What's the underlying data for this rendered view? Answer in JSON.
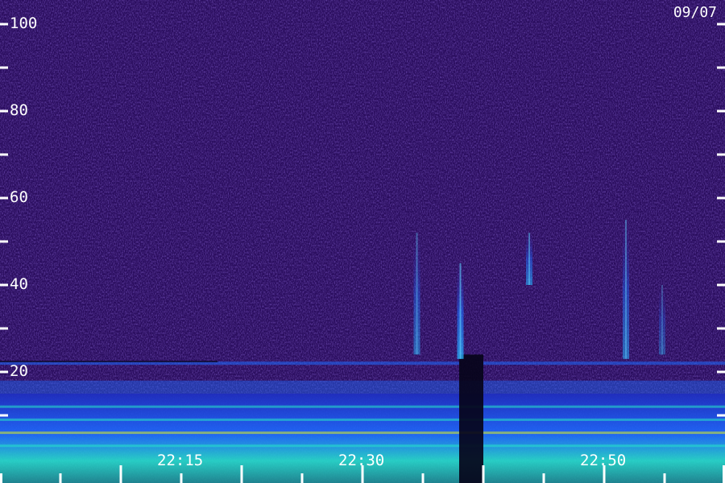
{
  "chart_data": {
    "type": "heatmap",
    "date_label": "09/07",
    "colors": {
      "background": "#2a0d5e",
      "low": "#3b1fb0",
      "mid": "#1e6bff",
      "high": "#27e6c8",
      "peak": "#d8f020",
      "tick": "#ffffff"
    },
    "y_axis": {
      "range": [
        0,
        100
      ],
      "labeled_ticks": [
        20,
        40,
        60,
        80,
        100
      ],
      "minor_ticks": [
        10,
        30,
        50,
        70,
        90
      ]
    },
    "x_axis": {
      "range_minutes": [
        0,
        60
      ],
      "labeled_ticks": [
        {
          "label": "22:15",
          "minute": 15
        },
        {
          "label": "22:30",
          "minute": 30
        },
        {
          "label": "22:50",
          "minute": 50
        }
      ],
      "tick_minutes": [
        0,
        5,
        10,
        15,
        20,
        25,
        30,
        35,
        40,
        45,
        50,
        55,
        60
      ],
      "major_tick_minutes": [
        10,
        20,
        30,
        40,
        50,
        60
      ]
    },
    "features": {
      "horizontal_line": {
        "level": 22,
        "intensity": 0.55
      },
      "low_band": {
        "from": 0,
        "to": 15,
        "intensity": 0.85
      },
      "gap": {
        "from_minute": 38,
        "to_minute": 40
      },
      "vertical_streaks": [
        {
          "minute": 34.5,
          "from": 24,
          "to": 52,
          "intensity": 0.5
        },
        {
          "minute": 38.1,
          "from": 23,
          "to": 45,
          "intensity": 0.75
        },
        {
          "minute": 43.8,
          "from": 40,
          "to": 52,
          "intensity": 0.6
        },
        {
          "minute": 51.8,
          "from": 23,
          "to": 55,
          "intensity": 0.55
        },
        {
          "minute": 54.8,
          "from": 24,
          "to": 40,
          "intensity": 0.35
        }
      ]
    }
  }
}
